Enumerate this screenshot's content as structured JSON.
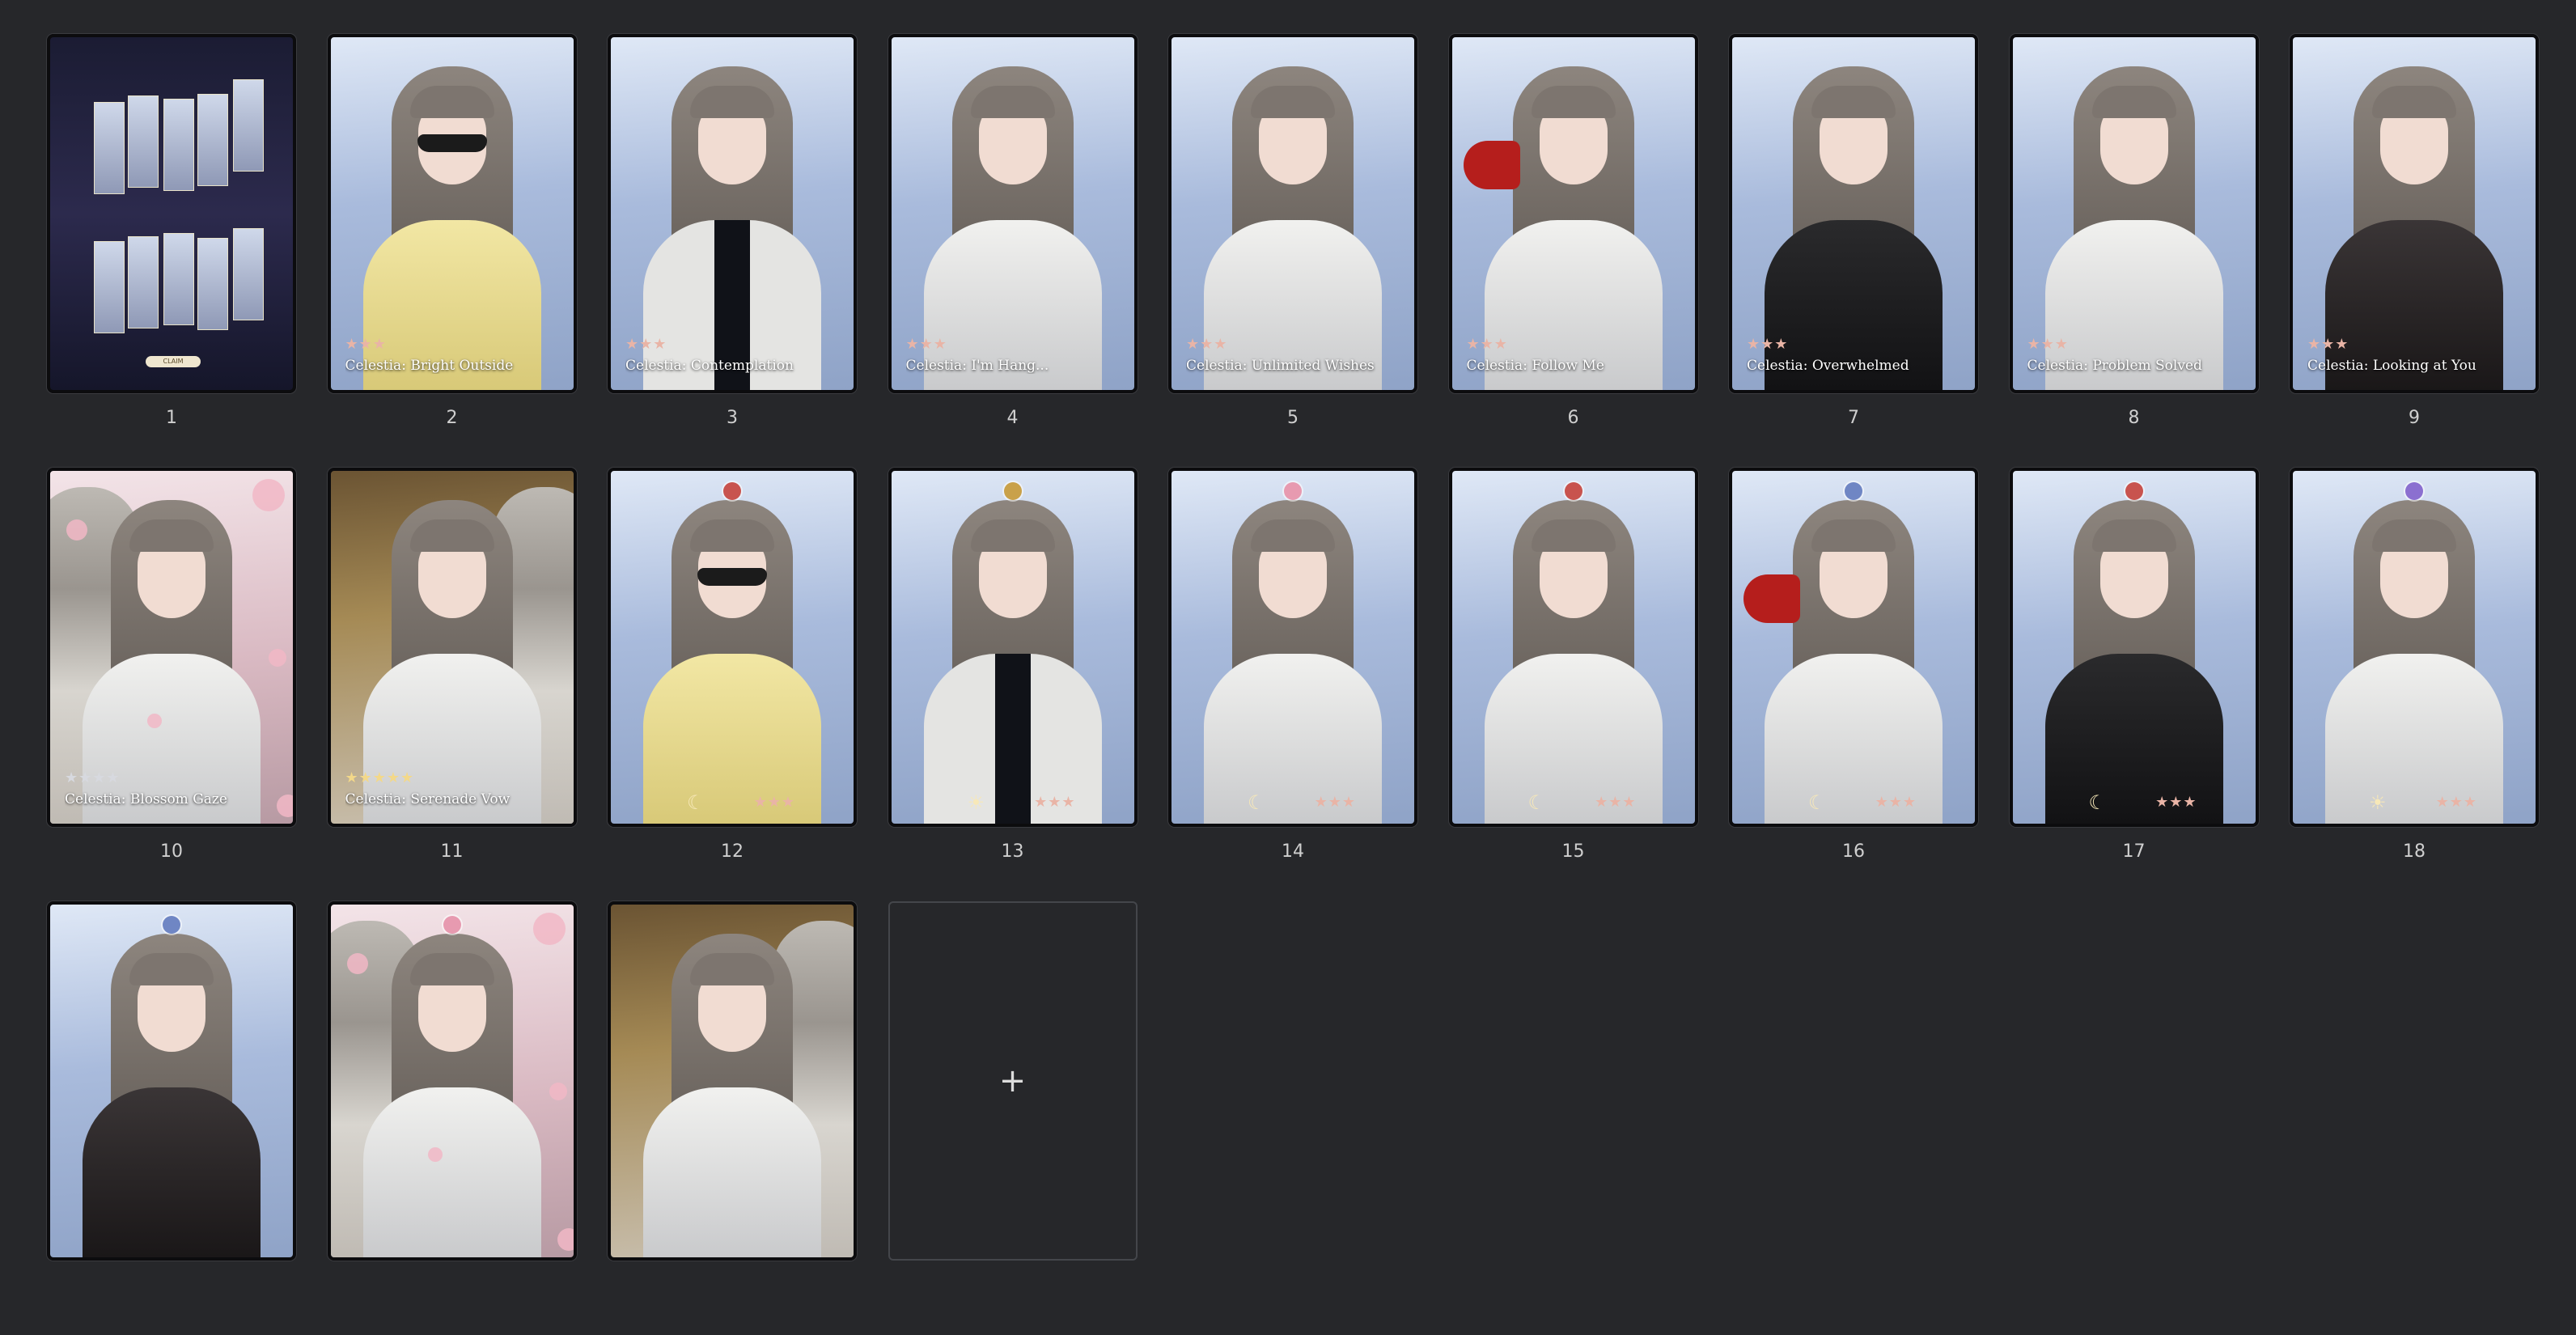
{
  "slides": [
    {
      "number": "1",
      "caption": "",
      "stars": "",
      "background": "dark",
      "outfit": "collage",
      "claim_label": "CLAIM"
    },
    {
      "number": "2",
      "caption": "Celestia: Bright Outside",
      "stars": "★★★",
      "background": "sky",
      "outfit": "yellow"
    },
    {
      "number": "3",
      "caption": "Celestia: Contemplation",
      "stars": "★★★",
      "background": "sky",
      "outfit": "coat"
    },
    {
      "number": "4",
      "caption": "Celestia: I'm Hang...",
      "stars": "★★★",
      "background": "sky",
      "outfit": "white"
    },
    {
      "number": "5",
      "caption": "Celestia: Unlimited Wishes",
      "stars": "★★★",
      "background": "sky",
      "outfit": "white"
    },
    {
      "number": "6",
      "caption": "Celestia: Follow Me",
      "stars": "★★★",
      "background": "sky",
      "outfit": "white"
    },
    {
      "number": "7",
      "caption": "Celestia: Overwhelmed",
      "stars": "★★★",
      "background": "sky",
      "outfit": "black"
    },
    {
      "number": "8",
      "caption": "Celestia: Problem Solved",
      "stars": "★★★",
      "background": "sky",
      "outfit": "white"
    },
    {
      "number": "9",
      "caption": "Celestia: Looking at You",
      "stars": "★★★",
      "background": "sky",
      "outfit": "sheer"
    },
    {
      "number": "10",
      "caption": "Celestia: Blossom Gaze",
      "stars": "★★★★",
      "background": "pink",
      "outfit": "white"
    },
    {
      "number": "11",
      "caption": "Celestia: Serenade Vow",
      "stars": "★★★★★",
      "background": "gold",
      "outfit": "white"
    },
    {
      "number": "12",
      "caption": "",
      "stars": "★★★",
      "background": "sky",
      "outfit": "yellow",
      "orb_color": "#c8534e",
      "phase_icon": "moon"
    },
    {
      "number": "13",
      "caption": "",
      "stars": "★★★",
      "background": "sky",
      "outfit": "coat",
      "orb_color": "#c9a14a",
      "phase_icon": "sun"
    },
    {
      "number": "14",
      "caption": "",
      "stars": "★★★",
      "background": "sky",
      "outfit": "white",
      "orb_color": "#e79ab0",
      "phase_icon": "moon"
    },
    {
      "number": "15",
      "caption": "",
      "stars": "★★★",
      "background": "sky",
      "outfit": "white",
      "orb_color": "#c8534e",
      "phase_icon": "moon"
    },
    {
      "number": "16",
      "caption": "",
      "stars": "★★★",
      "background": "sky",
      "outfit": "white",
      "orb_color": "#6f86c4",
      "phase_icon": "moon"
    },
    {
      "number": "17",
      "caption": "",
      "stars": "★★★",
      "background": "sky",
      "outfit": "black",
      "orb_color": "#c8534e",
      "phase_icon": "moon"
    },
    {
      "number": "18",
      "caption": "",
      "stars": "★★★",
      "background": "sky",
      "outfit": "white",
      "orb_color": "#8b6fd0",
      "phase_icon": "sun"
    },
    {
      "number": "",
      "caption": "",
      "stars": "",
      "background": "sky",
      "outfit": "sheer",
      "orb_color": "#6f86c4"
    },
    {
      "number": "",
      "caption": "",
      "stars": "",
      "background": "pink",
      "outfit": "white",
      "orb_color": "#e79ab0"
    },
    {
      "number": "",
      "caption": "",
      "stars": "",
      "background": "gold",
      "outfit": "white"
    }
  ],
  "add_tile": {
    "icon": "plus-icon",
    "symbol": "+"
  }
}
